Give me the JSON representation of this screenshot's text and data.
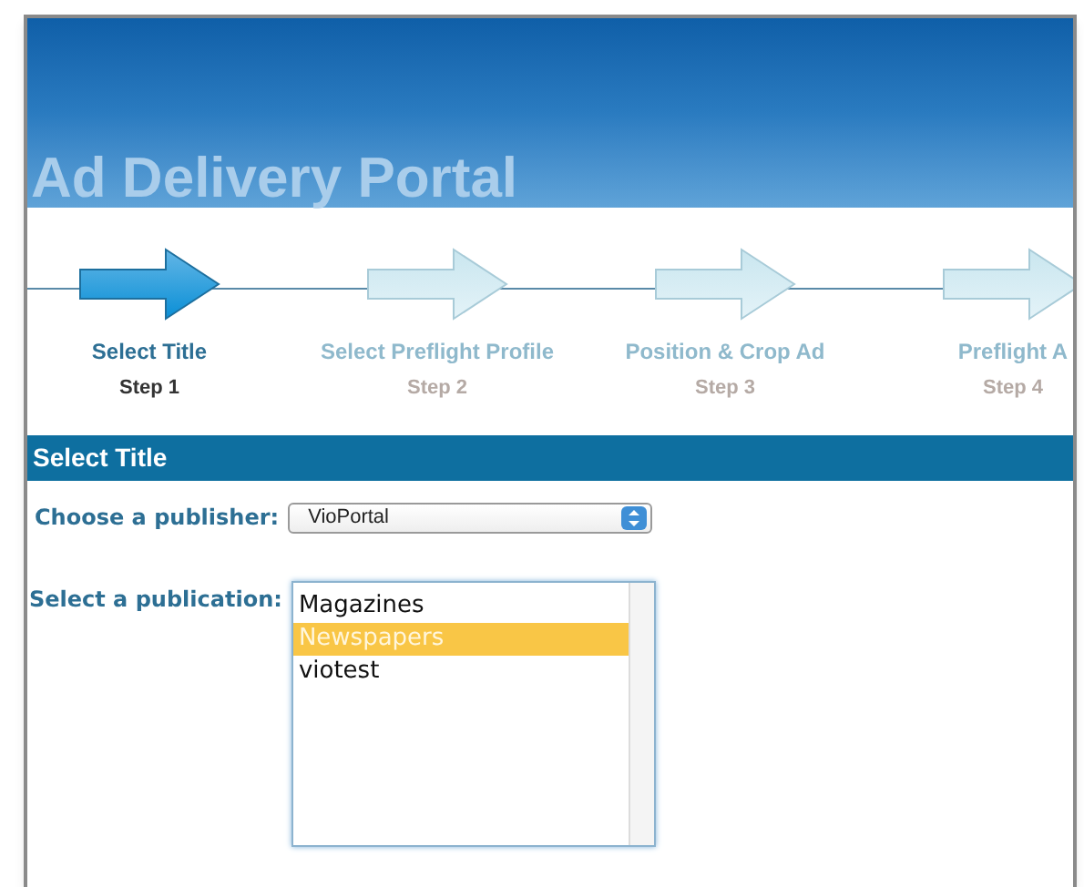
{
  "header": {
    "title": "Ad Delivery Portal"
  },
  "steps": [
    {
      "label": "Select Title",
      "step": "Step 1",
      "selected": true
    },
    {
      "label": "Select Preflight Profile",
      "step": "Step 2",
      "selected": false
    },
    {
      "label": "Position & Crop Ad",
      "step": "Step 3",
      "selected": false
    },
    {
      "label": "Preflight A",
      "step": "Step 4",
      "selected": false
    }
  ],
  "section": {
    "title": "Select Title"
  },
  "publisher": {
    "label": "Choose a publisher:",
    "value": "VioPortal"
  },
  "publication": {
    "label": "Select a publication:",
    "items": [
      {
        "label": "Magazines",
        "selected": false
      },
      {
        "label": "Newspapers",
        "selected": true
      },
      {
        "label": "viotest",
        "selected": false
      }
    ]
  }
}
